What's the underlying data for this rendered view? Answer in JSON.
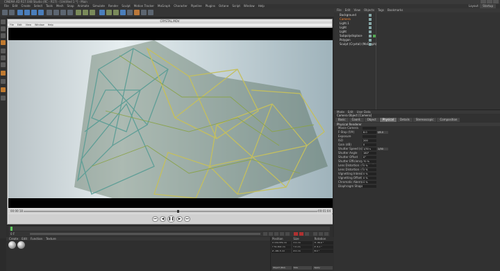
{
  "menubar": {
    "items": [
      "File",
      "Edit",
      "Create",
      "Select",
      "Tools",
      "Mesh",
      "Snap",
      "Animate",
      "Simulate",
      "Render",
      "Sculpt",
      "Motion Tracker",
      "MoGraph",
      "Character",
      "Pipeline",
      "Plugins",
      "Octane",
      "Script",
      "Window",
      "Help"
    ]
  },
  "layout": {
    "label": "Layout:",
    "value": "Startup"
  },
  "player": {
    "title": "CRYSTAL.MOV",
    "menu": [
      "File",
      "Edit",
      "View",
      "Window",
      "Help"
    ],
    "time_current": "00:00:18",
    "time_remaining": "-00:01:04"
  },
  "object_manager": {
    "menu": [
      "File",
      "Edit",
      "View",
      "Objects",
      "Tags",
      "Bookmarks"
    ],
    "objects": [
      {
        "name": "Background",
        "highlight": false
      },
      {
        "name": "Camera",
        "highlight": true
      },
      {
        "name": "Light.1",
        "highlight": false
      },
      {
        "name": "Light",
        "highlight": false
      },
      {
        "name": "Light",
        "highlight": false
      },
      {
        "name": "Subpolydisplace",
        "highlight": false
      },
      {
        "name": "Polygon",
        "highlight": false
      },
      {
        "name": "Sculpt (Crystal) (MoGraph)",
        "highlight": false
      }
    ]
  },
  "attribute_manager": {
    "menu": [
      "Mode",
      "Edit",
      "User Data"
    ],
    "object_title": "Camera Object [Camera]",
    "tabs": [
      "Basic",
      "Coord.",
      "Object",
      "Physical",
      "Details",
      "Stereoscopic",
      "Composition"
    ],
    "active_tab": "Physical",
    "section": "Physical Renderer",
    "properties": [
      {
        "label": "Movie Camera",
        "value": ""
      },
      {
        "label": "F-Stop (f/#)",
        "value": "8.0",
        "extra": "f/8.0"
      },
      {
        "label": "Exposure",
        "value": ""
      },
      {
        "label": "ISO",
        "value": "200"
      },
      {
        "label": "Gain (dB)",
        "value": "0"
      },
      {
        "label": "Shutter Speed (s)",
        "value": "1/30 s",
        "extra": "1/30"
      },
      {
        "label": "Shutter Angle",
        "value": "180°"
      },
      {
        "label": "Shutter Offset",
        "value": "0°"
      },
      {
        "label": "Shutter Efficiency",
        "value": "70 %"
      },
      {
        "label": "Lens Distortion - Quadratic",
        "value": "0 %"
      },
      {
        "label": "Lens Distortion - Cubic",
        "value": "0 %"
      },
      {
        "label": "Vignetting Intensity",
        "value": "0 %"
      },
      {
        "label": "Vignetting Offset",
        "value": "0 %"
      },
      {
        "label": "Chromatic Aberration",
        "value": "0 %"
      },
      {
        "label": "Diaphragm Shape",
        "value": ""
      }
    ]
  },
  "timeline": {
    "timecode": "0 F",
    "end": "90 F"
  },
  "material_manager": {
    "menu": [
      "Create",
      "Edit",
      "Function",
      "Texture"
    ]
  },
  "coordinates": {
    "headers": [
      "Position",
      "Size",
      "Rotation"
    ],
    "rows": [
      [
        "X  134.379 cm",
        "X  0 cm",
        "H  -36.9 °"
      ],
      [
        "Y  51.302 cm",
        "Y  0 cm",
        "P  -5.1 °"
      ],
      [
        "Z  -181.5 cm",
        "Z  0 cm",
        "B  0 °"
      ]
    ],
    "mode": "Object (Rel)",
    "size_mode": "Size",
    "apply_label": "Apply"
  },
  "window_title": "CINEMA 4D R17.048 Studio (RC - R17) - [Untitled 1 *] - Main"
}
